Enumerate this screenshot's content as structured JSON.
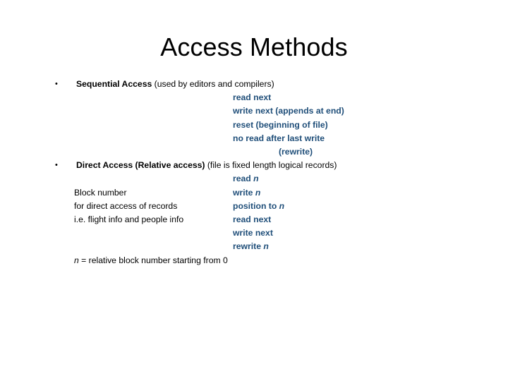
{
  "slide": {
    "title": "Access Methods",
    "background_color": "#FFFFFF",
    "accent_color": "#1F4E79",
    "text_color": "#000000",
    "bullet_glyph": "•"
  },
  "bullets": [
    {
      "heading_bold": "Sequential Access",
      "heading_plain": " (used by editors and compilers)",
      "operations": [
        {
          "text": "read next",
          "indent": "normal"
        },
        {
          "text": "write next (appends at end)",
          "indent": "normal"
        },
        {
          "text": "reset (beginning of file)",
          "indent": "normal"
        },
        {
          "text": "no read after last write",
          "indent": "normal"
        },
        {
          "text": "(rewrite)",
          "indent": "extra"
        }
      ]
    },
    {
      "heading_bold": "Direct Access (Relative access)",
      "heading_plain": "  (file is fixed length logical records)",
      "rows": [
        {
          "left": "",
          "right_pre": "read ",
          "right_italic": "n",
          "right_post": ""
        },
        {
          "left": "Block number",
          "right_pre": "write ",
          "right_italic": "n",
          "right_post": ""
        },
        {
          "left": "for direct access of records",
          "right_pre": "position to ",
          "right_italic": "n",
          "right_post": ""
        },
        {
          "left": "i.e. flight info and people info",
          "right_pre": "read next",
          "right_italic": "",
          "right_post": ""
        },
        {
          "left": "",
          "right_pre": "write next",
          "right_italic": "",
          "right_post": ""
        },
        {
          "left": "",
          "right_pre": "rewrite ",
          "right_italic": "n",
          "right_post": ""
        }
      ],
      "footnote_italic": "n",
      "footnote_text": " = relative block number starting from 0"
    }
  ]
}
